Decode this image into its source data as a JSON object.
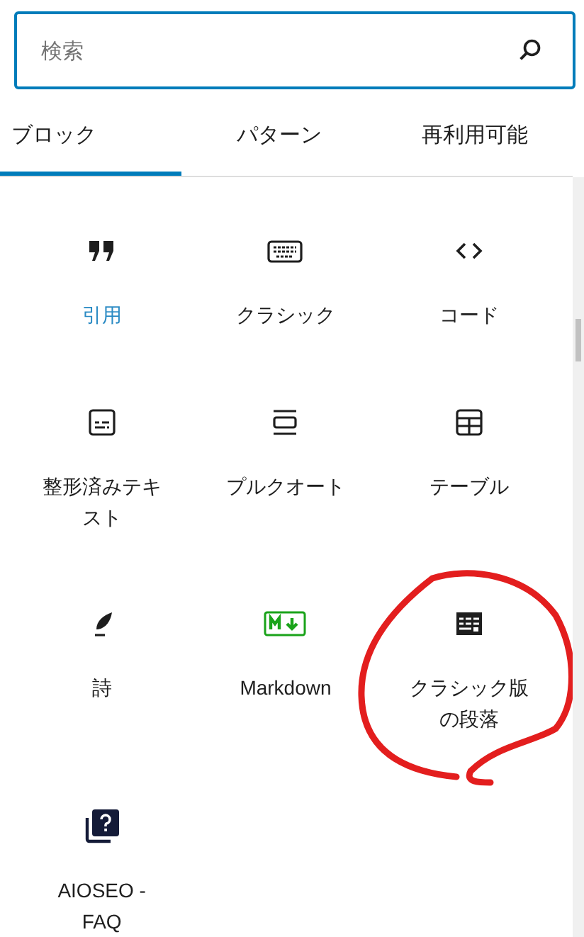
{
  "search": {
    "placeholder": "検索"
  },
  "tabs": [
    {
      "label": "ブロック",
      "selected": true
    },
    {
      "label": "パターン",
      "selected": false
    },
    {
      "label": "再利用可能",
      "selected": false
    }
  ],
  "blocks": [
    {
      "kind": "quote",
      "label": "引用",
      "selected": true
    },
    {
      "kind": "keyboard",
      "label": "クラシック",
      "selected": false
    },
    {
      "kind": "code",
      "label": "コード",
      "selected": false
    },
    {
      "kind": "preformatted",
      "label": "整形済みテキスト",
      "selected": false
    },
    {
      "kind": "pullquote",
      "label": "プルクオート",
      "selected": false
    },
    {
      "kind": "table",
      "label": "テーブル",
      "selected": false
    },
    {
      "kind": "verse",
      "label": "詩",
      "selected": false
    },
    {
      "kind": "markdown",
      "label": "Markdown",
      "selected": false
    },
    {
      "kind": "classic-paragraph",
      "label": "クラシック版の段落",
      "selected": false,
      "circled": true
    },
    {
      "kind": "faq",
      "label": "AIOSEO - FAQ",
      "selected": false
    }
  ]
}
